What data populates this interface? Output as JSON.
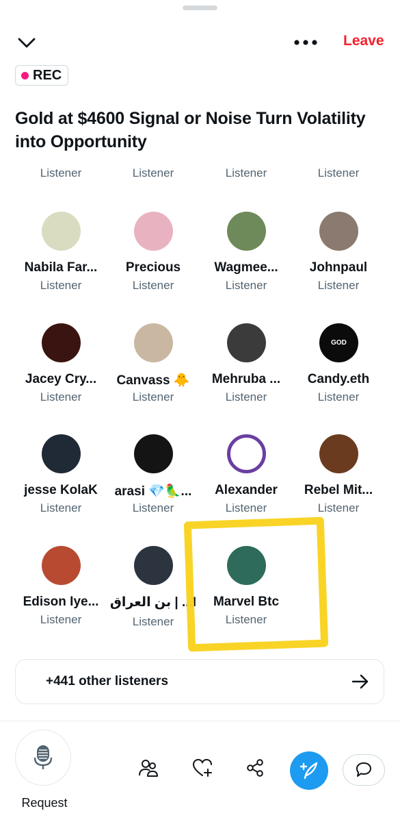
{
  "header": {
    "leave_label": "Leave",
    "rec_label": "REC",
    "title": "Gold at $4600 Signal or Noise Turn Volatility into Opportunity"
  },
  "top_row_roles": [
    "Listener",
    "Listener",
    "Listener",
    "Listener"
  ],
  "listeners": [
    {
      "name": "Nabila Far...",
      "role": "Listener",
      "avatar_color": "#d9dcc0"
    },
    {
      "name": "Precious",
      "role": "Listener",
      "avatar_color": "#e9b2c1"
    },
    {
      "name": "Wagmee...",
      "role": "Listener",
      "avatar_color": "#6f8a5a"
    },
    {
      "name": "Johnpaul",
      "role": "Listener",
      "avatar_color": "#8a7a70"
    },
    {
      "name": "Jacey Cry...",
      "role": "Listener",
      "avatar_color": "#3a1410"
    },
    {
      "name": "Canvass 🐥",
      "role": "Listener",
      "avatar_color": "#c9b7a1"
    },
    {
      "name": "Mehruba ...",
      "role": "Listener",
      "avatar_color": "#3b3b3b"
    },
    {
      "name": "Candy.eth",
      "role": "Listener",
      "avatar_color": "#0b0b0b",
      "avatar_text": "GOD"
    },
    {
      "name": "jesse KolaK",
      "role": "Listener",
      "avatar_color": "#1f2a36"
    },
    {
      "name": "arasi 💎🦜...",
      "role": "Listener",
      "avatar_color": "#141414"
    },
    {
      "name": "Alexander",
      "role": "Listener",
      "avatar_color": "#ffffff"
    },
    {
      "name": "Rebel Mit...",
      "role": "Listener",
      "avatar_color": "#6a3b1f"
    },
    {
      "name": "Edison Iye...",
      "role": "Listener",
      "avatar_color": "#b94a32"
    },
    {
      "name": "بن العراق | ...I",
      "role": "Listener",
      "avatar_color": "#2c3440"
    },
    {
      "name": "Marvel Btc",
      "role": "Listener",
      "avatar_color": "#2e6b5a"
    }
  ],
  "others": {
    "label": "+441 other listeners"
  },
  "toolbar": {
    "request_label": "Request"
  },
  "colors": {
    "accent": "#1d9bf0",
    "leave": "#f4212e",
    "rec_dot": "#f91880",
    "highlight": "#f9d21a"
  }
}
